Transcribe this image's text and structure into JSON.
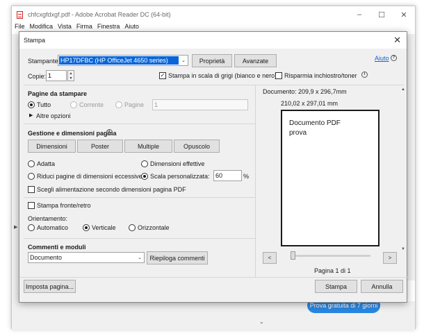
{
  "app": {
    "title": "chfcxgfdxgf.pdf - Adobe Acrobat Reader DC (64-bit)",
    "window_controls": [
      "–",
      "☐",
      "✕"
    ],
    "menu": [
      "File",
      "Modifica",
      "Vista",
      "Firma",
      "Finestra",
      "Aiuto"
    ],
    "trial_button": "Prova gratuita di 7 giorni"
  },
  "dialog": {
    "title": "Stampa",
    "help_link": "Aiuto",
    "printer": {
      "label": "Stampante:",
      "value": "HP17DFBC (HP OfficeJet 4650 series)",
      "properties_button": "Proprietà",
      "advanced_button": "Avanzate"
    },
    "copies": {
      "label": "Copie:",
      "value": "1"
    },
    "grayscale": {
      "label": "Stampa in scala di grigi (bianco e nero)",
      "checked": true
    },
    "save_ink": {
      "label": "Risparmia inchiostro/toner",
      "checked": false
    },
    "pages": {
      "heading": "Pagine da stampare",
      "all": "Tutto",
      "current": "Corrente",
      "pages": "Pagine",
      "pages_value": "1",
      "more_options": "Altre opzioni"
    },
    "sizing": {
      "heading": "Gestione e dimensioni pagina",
      "tabs": [
        "Dimensioni",
        "Poster",
        "Multiple",
        "Opuscolo"
      ],
      "fit": "Adatta",
      "actual_size": "Dimensioni effettive",
      "shrink": "Riduci pagine di dimensioni eccessive",
      "custom_scale": "Scala personalizzata:",
      "custom_scale_value": "60",
      "custom_scale_unit": "%",
      "paper_source": "Scegli alimentazione secondo dimensioni pagina PDF"
    },
    "duplex": {
      "label": "Stampa fronte/retro"
    },
    "orientation": {
      "label": "Orientamento:",
      "auto": "Automatico",
      "portrait": "Verticale",
      "landscape": "Orizzontale"
    },
    "comments": {
      "heading": "Commenti e moduli",
      "value": "Documento",
      "summarize_button": "Riepiloga commenti"
    },
    "preview": {
      "document_size": "Documento: 209,9 x 296,7mm",
      "page_size": "210,02 x 297,01 mm",
      "content_line1": "Documento PDF",
      "content_line2": "prova",
      "prev": "<",
      "next": ">",
      "page_indicator": "Pagina 1 di 1"
    },
    "page_setup_button": "Imposta pagina...",
    "print_button": "Stampa",
    "cancel_button": "Annulla"
  },
  "colors": {
    "accent": "#0a66d8",
    "link": "#1560d4",
    "trial": "#2a86e0"
  }
}
